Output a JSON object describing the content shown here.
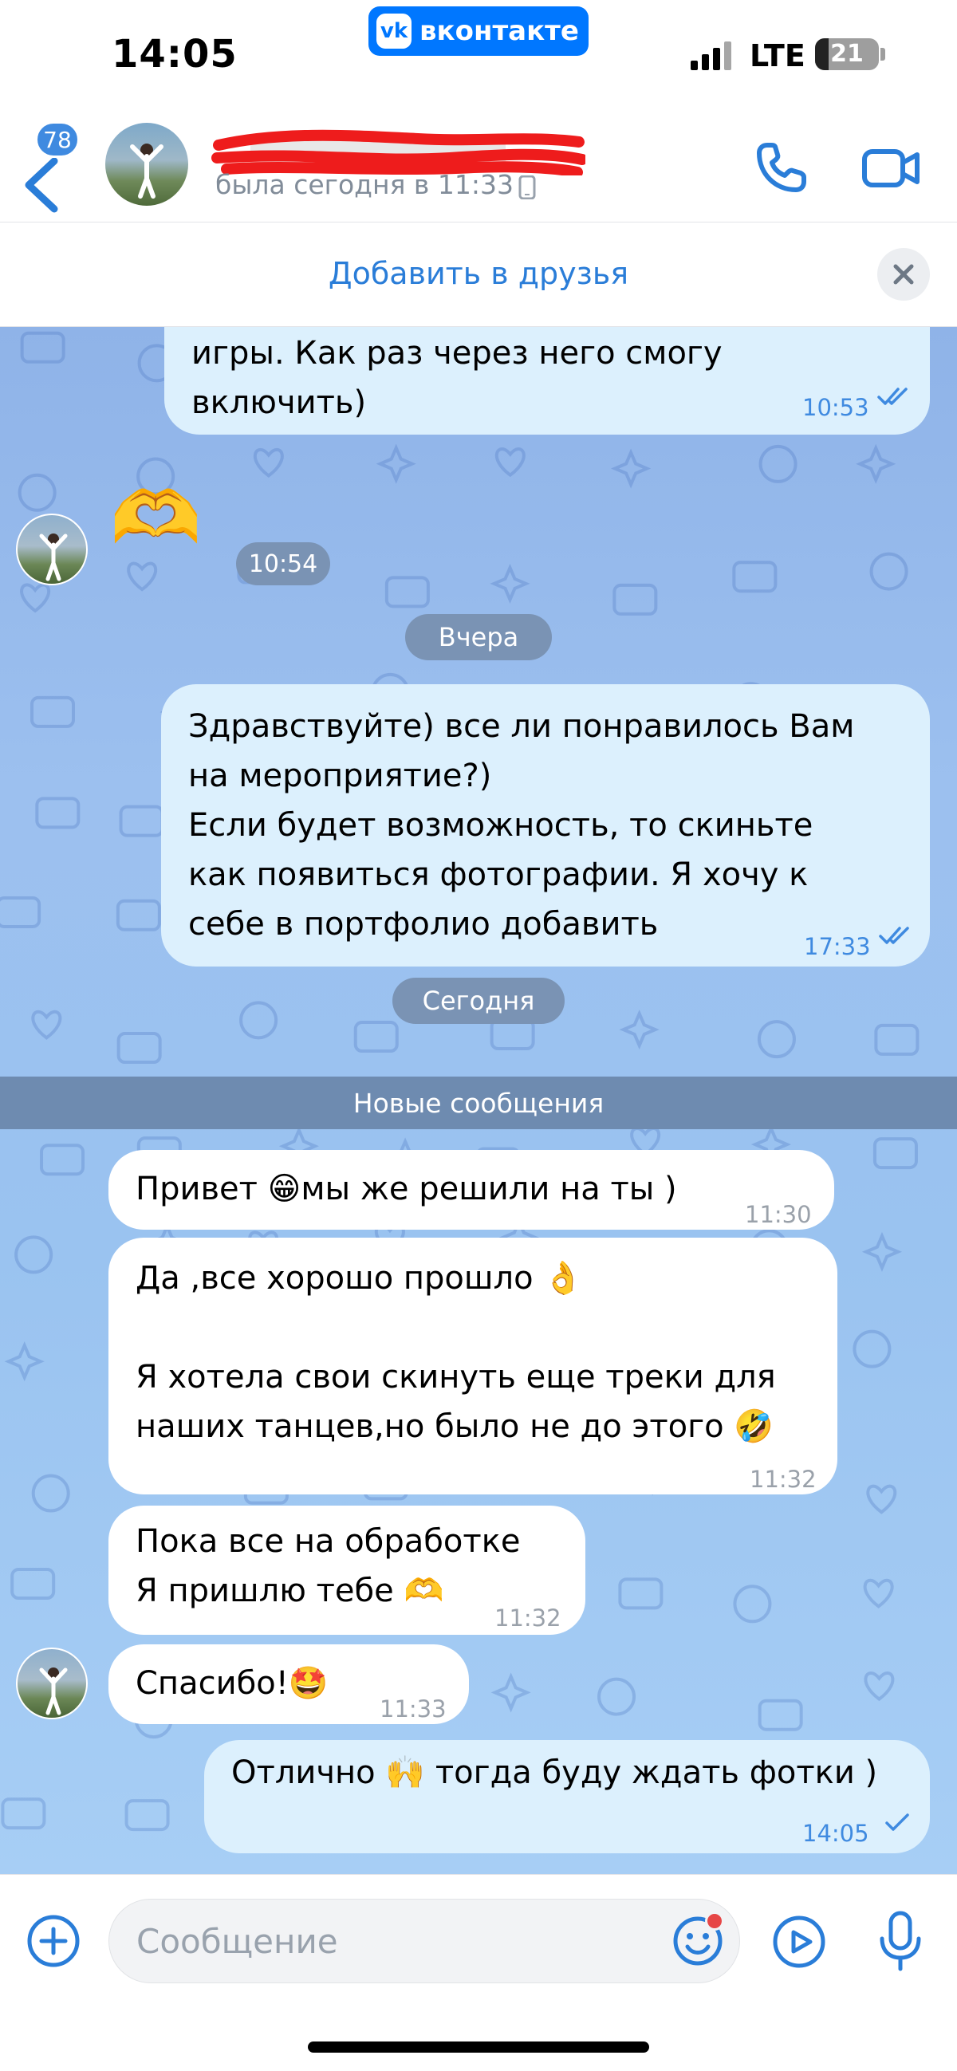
{
  "status_bar": {
    "time": "14:05",
    "app_pill": "вконтакте",
    "app_logo": "vk",
    "carrier": "LTE",
    "battery": "21",
    "battery_fraction": 0.21
  },
  "header": {
    "unread_badge": "78",
    "last_seen": "была сегодня в 11:33",
    "icons": [
      "back-arrow-icon",
      "phone-icon",
      "video-camera-icon",
      "mobile-device-icon"
    ]
  },
  "banner": {
    "add_friend": "Добавить в друзья",
    "close_icon": "close-icon"
  },
  "messages": {
    "m1": {
      "text": "игры. Как раз через него смогу\nвключить)",
      "time": "10:53"
    },
    "m2": {
      "emoji": "🫶",
      "time": "10:54"
    },
    "date_yesterday": "Вчера",
    "m3": {
      "text": "Здравствуйте) все ли понравилось Вам\nна мероприятие?)\nЕсли будет возможность, то скиньте\nкак появиться фотографии. Я хочу к\nсебе в портфолио добавить",
      "time": "17:33"
    },
    "date_today": "Сегодня",
    "new_messages": "Новые сообщения",
    "m4": {
      "text": "Привет 😁мы же решили на ты )",
      "time": "11:30"
    },
    "m5": {
      "text": "Да ,все хорошо прошло 👌\n\nЯ хотела свои скинуть еще треки для\nнаших танцев,но было не до этого 🤣",
      "time": "11:32"
    },
    "m6": {
      "text": "Пока все на обработке\nЯ пришлю тебе 🫶",
      "time": "11:32"
    },
    "m7": {
      "text": "Спасибо!🤩",
      "time": "11:33"
    },
    "m8": {
      "text": "Отлично 🙌 тогда буду ждать фотки )",
      "time": "14:05"
    }
  },
  "composer": {
    "placeholder": "Сообщение",
    "value": "",
    "icons": [
      "plus-icon",
      "sticker-smile-icon",
      "video-message-icon",
      "microphone-icon"
    ]
  },
  "colors": {
    "accent": "#2a7dd8",
    "vk_blue": "#0077ff",
    "outgoing_bubble": "#dcf0fd",
    "incoming_bubble": "#ffffff",
    "chat_wallpaper": "#9cc0ef",
    "redaction": "#ee1c1c"
  }
}
